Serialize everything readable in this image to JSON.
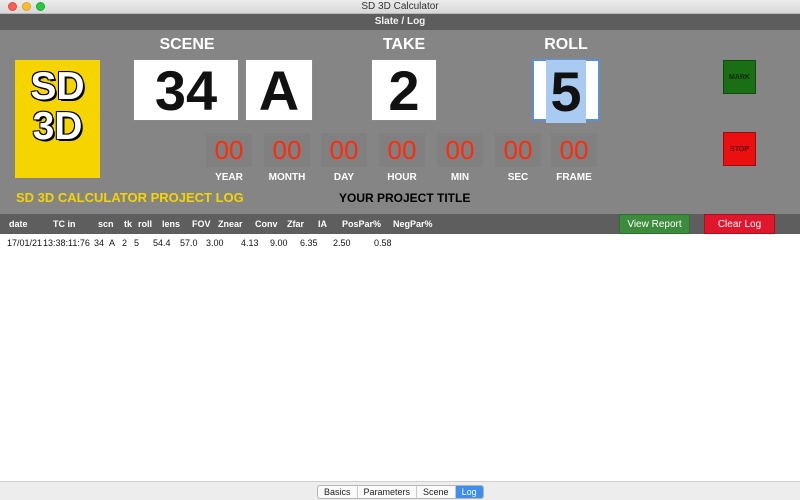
{
  "window": {
    "title": "SD 3D Calculator",
    "subtitle": "Slate / Log"
  },
  "logo": {
    "line1": "SD",
    "line2": "3D"
  },
  "slate": {
    "scene_label": "SCENE",
    "take_label": "TAKE",
    "roll_label": "ROLL",
    "scene_number": "34",
    "scene_letter": "A",
    "take": "2",
    "roll": "5"
  },
  "buttons": {
    "mark": "MARK",
    "stop": "STOP",
    "view_report": "View Report",
    "clear_log": "Clear Log"
  },
  "timecode": {
    "values": [
      "00",
      "00",
      "00",
      "00",
      "00",
      "00",
      "00"
    ],
    "labels": [
      "YEAR",
      "MONTH",
      "DAY",
      "HOUR",
      "MIN",
      "SEC",
      "FRAME"
    ]
  },
  "project": {
    "log_label": "SD 3D CALCULATOR PROJECT LOG",
    "title": "YOUR PROJECT TITLE"
  },
  "log": {
    "headers": [
      "date",
      "TC in",
      "scn",
      "tk",
      "roll",
      "lens",
      "FOV",
      "Znear",
      "Conv",
      "Zfar",
      "IA",
      "PosPar%",
      "NegPar%"
    ],
    "rows": [
      {
        "date": "17/01/21",
        "tc_in": "13:38:11:76",
        "scn": "34",
        "scn_letter": "A",
        "tk": "2",
        "roll": "5",
        "lens": "54.4",
        "fov": "57.0",
        "znear": "3.00",
        "conv": "4.13",
        "zfar": "9.00",
        "ia": "6.35",
        "pospar": "2.50",
        "negpar": "0.58"
      }
    ]
  },
  "tabs": [
    {
      "label": "Basics",
      "active": false
    },
    {
      "label": "Parameters",
      "active": false
    },
    {
      "label": "Scene",
      "active": false
    },
    {
      "label": "Log",
      "active": true
    }
  ],
  "colors": {
    "accent": "#3d8ef0",
    "timecode": "#ff2a0a",
    "logo_bg": "#f5d400",
    "mark": "#1a6e13",
    "stop": "#ec0f0f"
  }
}
